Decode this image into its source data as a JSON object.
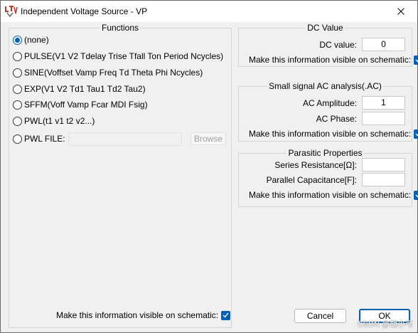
{
  "window": {
    "title": "Independent Voltage Source - VP"
  },
  "functions": {
    "title": "Functions",
    "options": [
      {
        "label": "(none)",
        "checked": true
      },
      {
        "label": "PULSE(V1 V2 Tdelay Trise Tfall Ton Period Ncycles)",
        "checked": false
      },
      {
        "label": "SINE(Voffset Vamp Freq Td Theta Phi Ncycles)",
        "checked": false
      },
      {
        "label": "EXP(V1 V2 Td1 Tau1 Td2 Tau2)",
        "checked": false
      },
      {
        "label": "SFFM(Voff Vamp Fcar MDI Fsig)",
        "checked": false
      },
      {
        "label": "PWL(t1 v1 t2 v2...)",
        "checked": false
      },
      {
        "label": "PWL FILE:",
        "checked": false
      }
    ],
    "pwl_file_value": "",
    "browse_label": "Browse",
    "visible_label": "Make this information visible on schematic:",
    "visible_checked": true
  },
  "dc_value": {
    "title": "DC Value",
    "field_label": "DC value:",
    "field_value": "0",
    "visible_label": "Make this information visible on schematic:",
    "visible_checked": true
  },
  "ac_analysis": {
    "title": "Small signal AC analysis(.AC)",
    "amplitude_label": "AC Amplitude:",
    "amplitude_value": "1",
    "phase_label": "AC Phase:",
    "phase_value": "",
    "visible_label": "Make this information visible on schematic:",
    "visible_checked": true
  },
  "parasitic": {
    "title": "Parasitic Properties",
    "series_resistance_label": "Series Resistance[Ω]:",
    "series_resistance_value": "",
    "parallel_capacitance_label": "Parallel Capacitance[F]:",
    "parallel_capacitance_value": "",
    "visible_label": "Make this information visible on schematic:",
    "visible_checked": true
  },
  "buttons": {
    "cancel_label": "Cancel",
    "ok_label": "OK"
  },
  "watermark": "CSDN @胡小弓",
  "colors": {
    "accent": "#005fb8",
    "background": "#f0f0f0",
    "titlebar": "#ffffff",
    "logo_red": "#c0392b"
  },
  "icons": {
    "app": "ltspice-icon",
    "close": "close-icon",
    "check": "checkmark-icon"
  }
}
